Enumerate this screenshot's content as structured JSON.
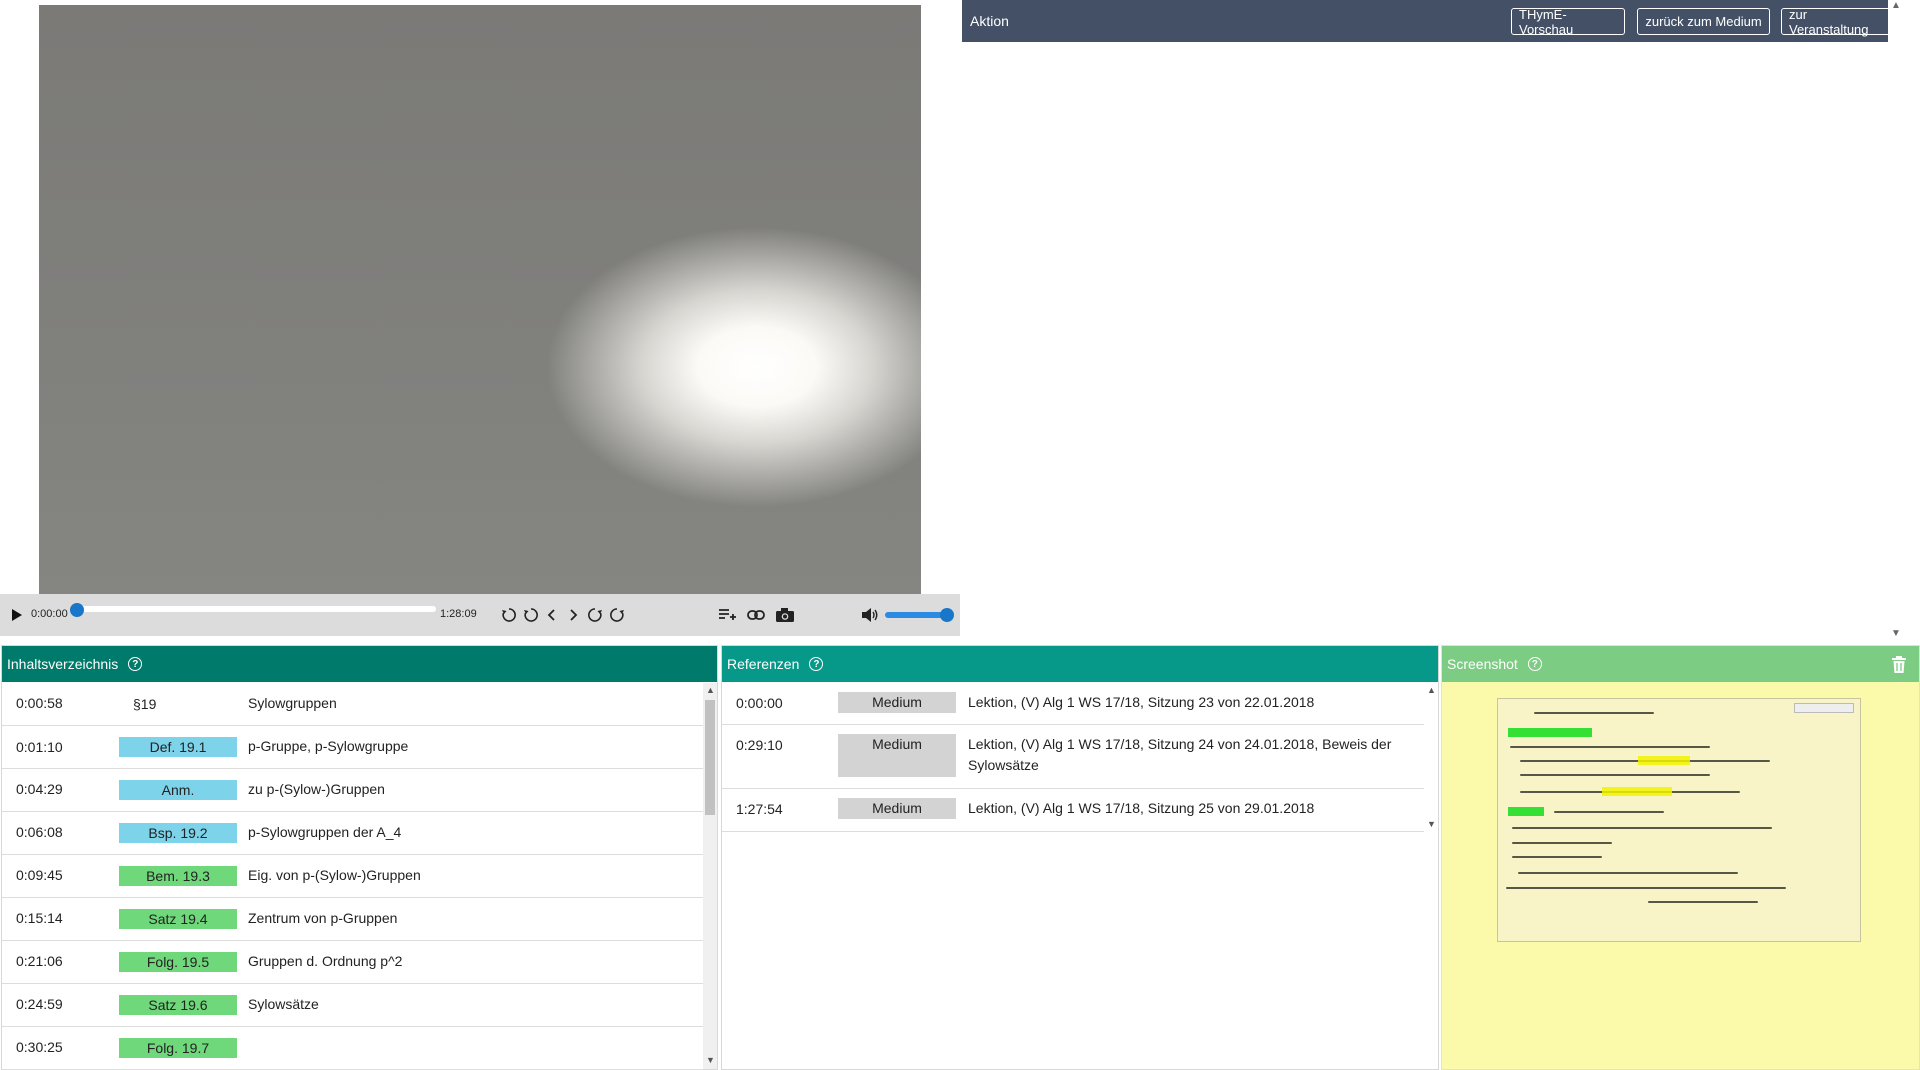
{
  "video": {
    "current_time": "0:00:00",
    "duration": "1:28:09"
  },
  "action": {
    "title": "Aktion",
    "buttons": [
      "THymE-Vorschau",
      "zurück zum Medium",
      "zur Veranstaltung"
    ]
  },
  "toc": {
    "title": "Inhaltsverzeichnis",
    "rows": [
      {
        "time": "0:00:58",
        "tag": "§19",
        "tag_color": "",
        "desc": "Sylowgruppen"
      },
      {
        "time": "0:01:10",
        "tag": "Def. 19.1",
        "tag_color": "#7dd3ea",
        "desc": "p-Gruppe, p-Sylowgruppe"
      },
      {
        "time": "0:04:29",
        "tag": "Anm.",
        "tag_color": "#7dd3ea",
        "desc": "zu p-(Sylow-)Gruppen"
      },
      {
        "time": "0:06:08",
        "tag": "Bsp. 19.2",
        "tag_color": "#7dd3ea",
        "desc": "p-Sylowgruppen der A_4"
      },
      {
        "time": "0:09:45",
        "tag": "Bem. 19.3",
        "tag_color": "#6ed87a",
        "desc": "Eig. von p-(Sylow-)Gruppen"
      },
      {
        "time": "0:15:14",
        "tag": "Satz 19.4",
        "tag_color": "#6ed87a",
        "desc": "Zentrum von p-Gruppen"
      },
      {
        "time": "0:21:06",
        "tag": "Folg. 19.5",
        "tag_color": "#6ed87a",
        "desc": "Gruppen d. Ordnung p^2"
      },
      {
        "time": "0:24:59",
        "tag": "Satz 19.6",
        "tag_color": "#6ed87a",
        "desc": "Sylowsätze"
      },
      {
        "time": "0:30:25",
        "tag": "Folg. 19.7",
        "tag_color": "#6ed87a",
        "desc": ""
      }
    ]
  },
  "refs": {
    "title": "Referenzen",
    "rows": [
      {
        "time": "0:00:00",
        "tag": "Medium",
        "desc": "Lektion, (V) Alg 1 WS 17/18, Sitzung 23 von 22.01.2018"
      },
      {
        "time": "0:29:10",
        "tag": "Medium",
        "desc": "Lektion, (V) Alg 1 WS 17/18, Sitzung 24 von 24.01.2018, Beweis der Sylowsätze"
      },
      {
        "time": "1:27:54",
        "tag": "Medium",
        "desc": "Lektion, (V) Alg 1 WS 17/18, Sitzung 25 von 29.01.2018"
      }
    ]
  },
  "screenshot": {
    "title": "Screenshot"
  },
  "colors": {
    "toc_header": "#007a6a",
    "refs_header": "#06998a",
    "shot_header": "#7dcc83",
    "shot_body": "#fafaaa",
    "action_bar": "#435066"
  }
}
